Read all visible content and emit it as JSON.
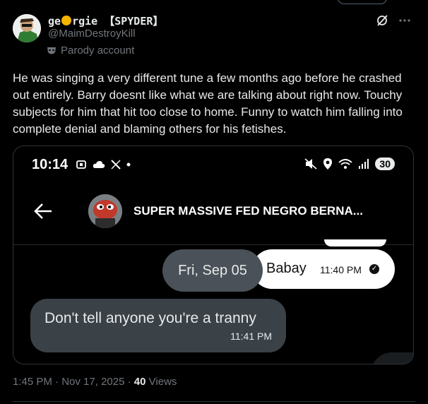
{
  "author": {
    "name_prefix": "ge",
    "name_suffix": "rgie 【SPYDER】",
    "handle": "@MaimDestroyKill",
    "label": "Parody account"
  },
  "tweet": {
    "text": "He was singing a very different tune a few months ago before he crashed out entirely. Barry doesnt like what we are talking about right now. Touchy subjects for him that hit too close to home. Funny to watch him falling into complete denial and blaming others for his fetishes.",
    "time": "1:45 PM",
    "date": "Nov 17, 2025",
    "views_count": "40",
    "views_label": "Views"
  },
  "media": {
    "status_bar": {
      "time": "10:14",
      "battery": "30"
    },
    "chat": {
      "contact_name": "SUPER MASSIVE FED NEGRO BERNA...",
      "date_chip": "Fri, Sep 05",
      "outgoing": {
        "text": "Babay",
        "time": "11:40 PM"
      },
      "incoming": {
        "text": "Don't tell anyone you're a tranny",
        "time": "11:41 PM"
      }
    }
  },
  "icons": [
    "grok-icon",
    "more-icon",
    "parody-mask-icon",
    "back-arrow-icon"
  ],
  "colors": {
    "background": "#000000",
    "text": "#e7e9ea",
    "muted": "#71767b",
    "incoming_bubble": "#3a4147",
    "outgoing_bubble": "#ffffff"
  }
}
